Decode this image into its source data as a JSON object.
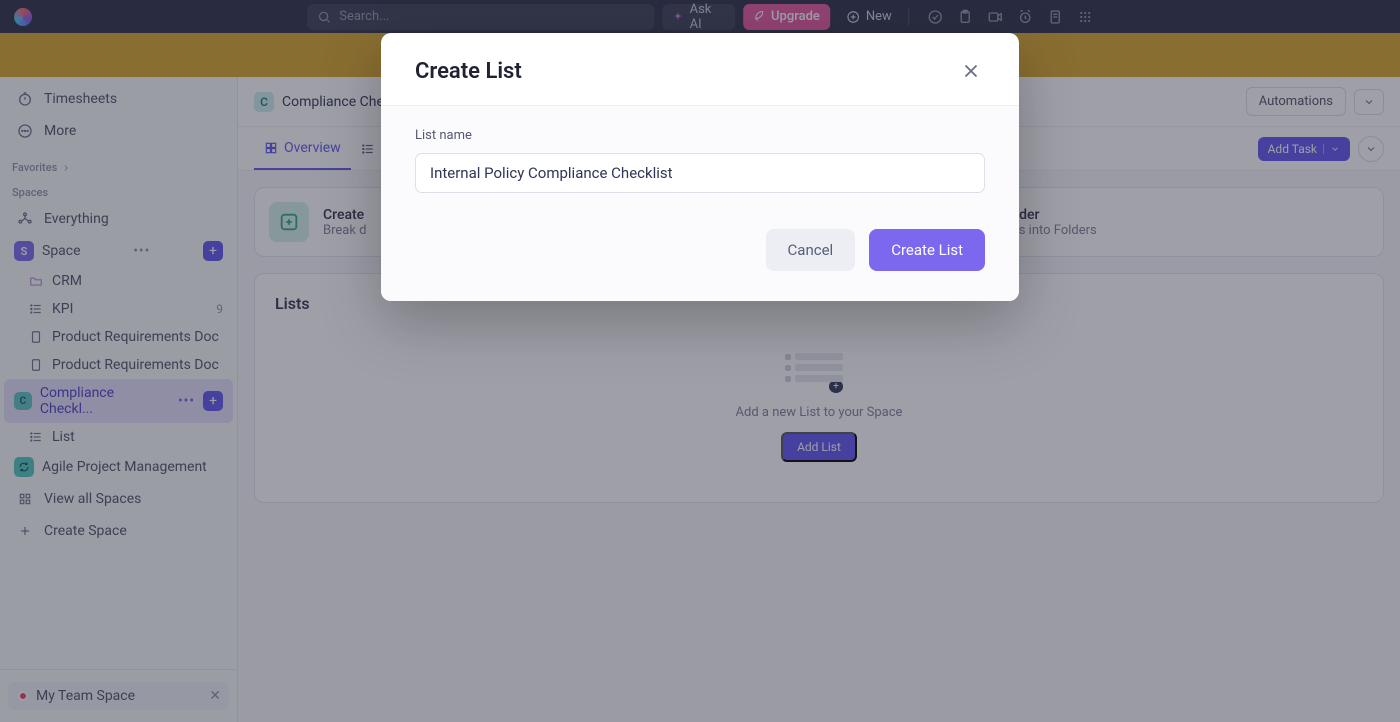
{
  "topbar": {
    "search_placeholder": "Search...",
    "ask_ai": "Ask AI",
    "upgrade": "Upgrade",
    "new": "New"
  },
  "sidebar": {
    "timesheets": "Timesheets",
    "more": "More",
    "favorites_heading": "Favorites",
    "spaces_heading": "Spaces",
    "everything": "Everything",
    "space": "Space",
    "space_initial": "S",
    "items": {
      "crm": "CRM",
      "kpi": "KPI",
      "kpi_count": "9",
      "prd1": "Product Requirements Doc",
      "prd2": "Product Requirements Doc",
      "compliance": "Compliance Checkl...",
      "compliance_initial": "C",
      "list": "List",
      "agile": "Agile Project Management"
    },
    "view_all": "View all Spaces",
    "create_space": "Create Space",
    "team_chip": "My Team Space"
  },
  "breadcrumb": {
    "initial": "C",
    "label": "Compliance Che"
  },
  "automations": "Automations",
  "tabs": {
    "overview": "Overview"
  },
  "actions": {
    "add_task": "Add Task"
  },
  "hints": {
    "card1_title": "Create",
    "card1_sub": "Break d",
    "card2_title": "Create your first Folder",
    "card2_sub": "Organize your projects into Folders"
  },
  "lists": {
    "heading": "Lists",
    "empty_text": "Add a new List to your Space",
    "add_list": "Add List"
  },
  "modal": {
    "title": "Create List",
    "field_label": "List name",
    "input_value": "Internal Policy Compliance Checklist",
    "cancel": "Cancel",
    "submit": "Create List"
  }
}
